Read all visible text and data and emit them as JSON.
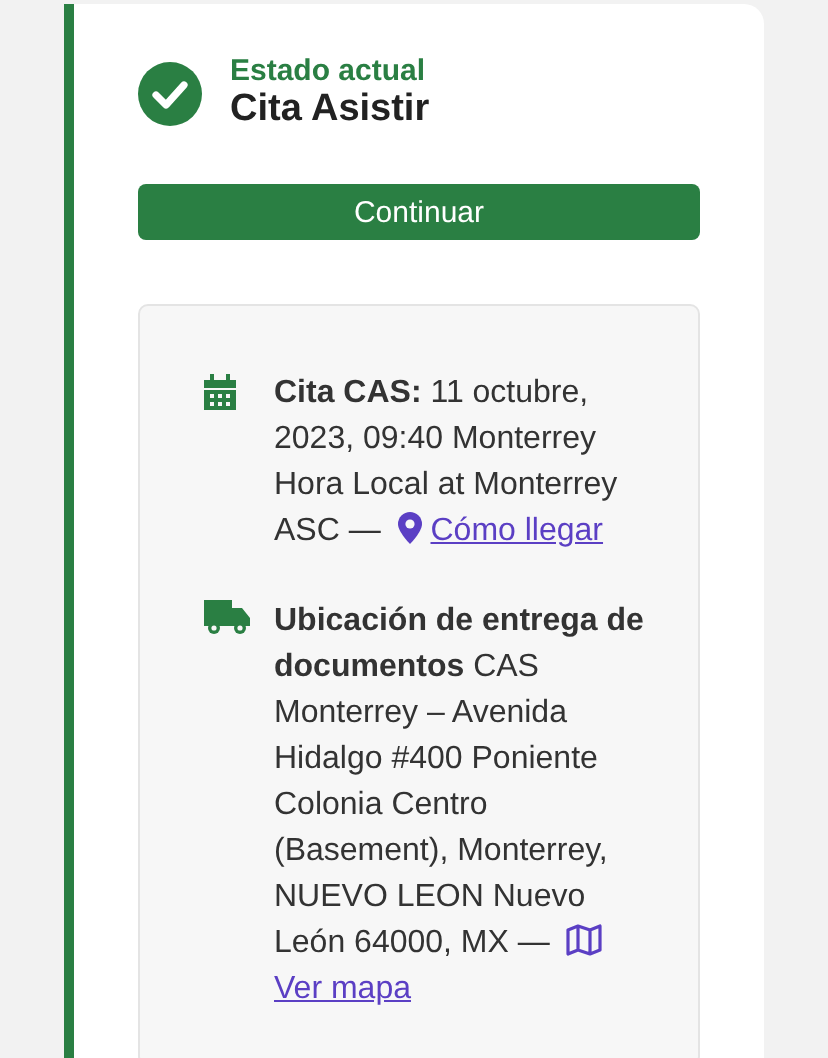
{
  "status": {
    "label": "Estado actual",
    "value": "Cita Asistir",
    "done": true
  },
  "button": "Continuar",
  "details": [
    {
      "kind": "calendar",
      "text": "**Cita CAS:** 11 octubre, 2023, 09:40 Monterrey Hora Local at Monterrey ASC —",
      "link": "Cómo llegar"
    },
    {
      "kind": "truck",
      "text": "**Ubicación de entrega de documentos** CAS Monterrey – Avenida Hidalgo #400 Poniente Colonia Centro (Basement), Monterrey, NUEVO LEON Nuevo León 64000, MX —",
      "link": "Ver mapa"
    }
  ]
}
